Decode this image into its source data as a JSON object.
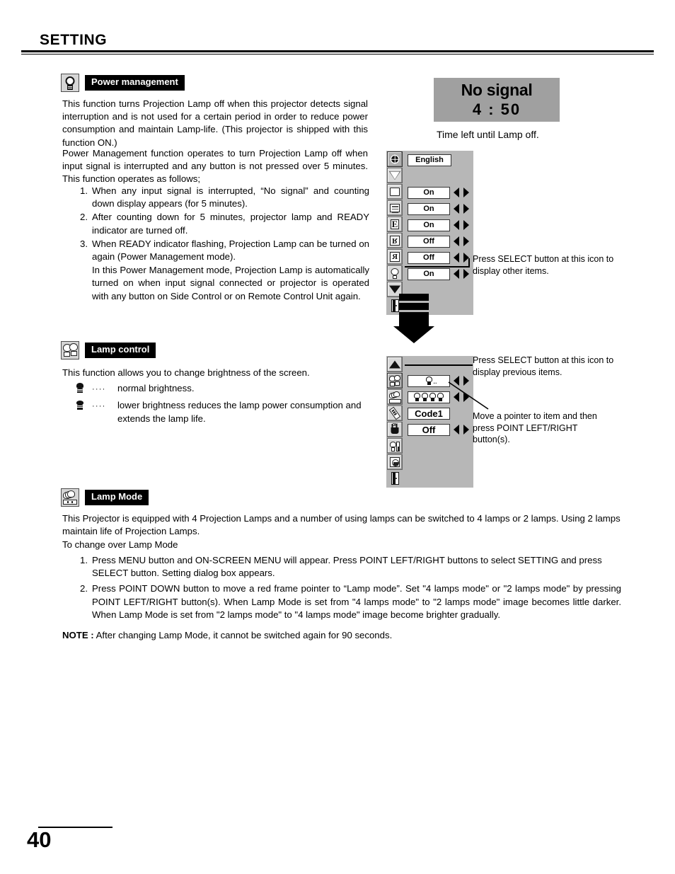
{
  "header": {
    "title": "SETTING"
  },
  "footer": {
    "page_number": "40"
  },
  "sections": {
    "power_management": {
      "icon_name": "power-management-lamp-icon",
      "label": "Power management",
      "paragraphs": [
        "This function turns Projection Lamp off when this projector detects signal interruption and is not used for a certain period in order to reduce power consumption and maintain Lamp-life.  (This projector is shipped with this function ON.)",
        "Power Management function operates to turn Projection Lamp off when input signal is interrupted and any button is not pressed over 5 minutes.  This function operates as follows;"
      ],
      "steps": [
        {
          "num": "1.",
          "text": "When any input signal is interrupted, “No signal” and counting down display appears (for 5 minutes)."
        },
        {
          "num": "2.",
          "text": "After counting down for 5 minutes, projector lamp and READY indicator are turned off."
        },
        {
          "num": "3.",
          "text": "When READY indicator flashing, Projection Lamp can be turned on again (Power Management mode)."
        },
        {
          "num": "",
          "text": "In this Power Management mode, Projection Lamp is automatically turned on when input signal connected or projector is operated with any button on Side Control or on Remote Control Unit again."
        }
      ]
    },
    "lamp_control": {
      "icon_name": "lamp-control-icon",
      "label": "Lamp control",
      "intro": "This function allows you to change brightness of the screen.",
      "items": [
        {
          "glyph": "lamp-normal-glyph",
          "dots": "····",
          "text": "normal brightness."
        },
        {
          "glyph": "lamp-eco-glyph",
          "dots": "····",
          "text": "lower brightness reduces the lamp power consumption and extends the lamp life."
        }
      ]
    },
    "lamp_mode": {
      "icon_name": "lamp-mode-icon",
      "label": "Lamp Mode",
      "paragraphs": [
        "This Projector is equipped with 4 Projection Lamps and a number of using lamps can be switched to 4 lamps or 2 lamps. Using 2 lamps maintain life of Projection Lamps.",
        "To change over Lamp Mode"
      ],
      "steps": [
        {
          "num": "1.",
          "text": "Press MENU button and ON-SCREEN MENU will appear.  Press POINT LEFT/RIGHT buttons to select SETTING and press SELECT button.  Setting dialog box appears."
        },
        {
          "num": "2.",
          "text": "Press POINT DOWN button to move a red frame pointer to “Lamp mode”.  Set \"4 lamps mode\" or \"2 lamps mode\" by pressing POINT LEFT/RIGHT button(s).  When Lamp Mode is set from \"4 lamps mode\" to \"2 lamps mode\" image becomes little darker.  When Lamp Mode is set from \"2 lamps mode\" to \"4 lamps mode\" image become brighter gradually."
        }
      ],
      "note_label": "NOTE :",
      "note_text": "After changing Lamp Mode, it cannot be switched again for 90 seconds."
    }
  },
  "osd_no_signal": {
    "title": "No signal",
    "time": "4 : 50",
    "caption": "Time left until Lamp off.",
    "background_color": "#a0a0a0"
  },
  "menu_page1": {
    "icons": [
      {
        "name": "language-globe-icon",
        "selected": true
      },
      {
        "name": "keystone-icon",
        "selected": false
      },
      {
        "name": "blue-back-icon",
        "selected": false
      },
      {
        "name": "display-icon",
        "selected": false
      },
      {
        "name": "ceiling-icon",
        "selected": false
      },
      {
        "name": "rear-icon",
        "selected": false
      },
      {
        "name": "flip-icon",
        "selected": false
      },
      {
        "name": "lamp-icon",
        "selected": false
      },
      {
        "name": "scroll-down-arrow-icon",
        "selected": false
      },
      {
        "name": "exit-icon",
        "selected": false
      }
    ],
    "rows": [
      {
        "value": "English",
        "arrows": false
      },
      {
        "value": "",
        "arrows": false
      },
      {
        "value": "On",
        "arrows": true
      },
      {
        "value": "On",
        "arrows": true
      },
      {
        "value": "On",
        "arrows": true
      },
      {
        "value": "Off",
        "arrows": true
      },
      {
        "value": "Off",
        "arrows": true
      },
      {
        "value": "On",
        "arrows": true
      }
    ]
  },
  "menu_page2": {
    "icons": [
      {
        "name": "scroll-up-arrow-icon",
        "selected": false
      },
      {
        "name": "lamp-control-icon",
        "selected": true
      },
      {
        "name": "lamp-mode-icon",
        "selected": false
      },
      {
        "name": "remote-control-code-icon",
        "selected": false
      },
      {
        "name": "power-plug-on-icon",
        "selected": false
      },
      {
        "name": "lamp-counter-icon",
        "selected": false
      },
      {
        "name": "lamp-counter-reset-icon",
        "selected": false
      },
      {
        "name": "exit-icon",
        "selected": false
      }
    ],
    "rows": [
      {
        "glyph": "single-lamp-glyph",
        "value": "",
        "arrows": true
      },
      {
        "glyph": "four-lamps-glyph",
        "value": "",
        "arrows": true
      },
      {
        "glyph": "",
        "value": "Code1",
        "arrows": false
      },
      {
        "glyph": "",
        "value": "Off",
        "arrows": true
      }
    ]
  },
  "annotations": {
    "a1": "Press SELECT button at this icon to display other items.",
    "a2": "Press SELECT button at this icon to display previous items.",
    "a3": "Move a pointer to item and then press POINT LEFT/RIGHT button(s)."
  }
}
